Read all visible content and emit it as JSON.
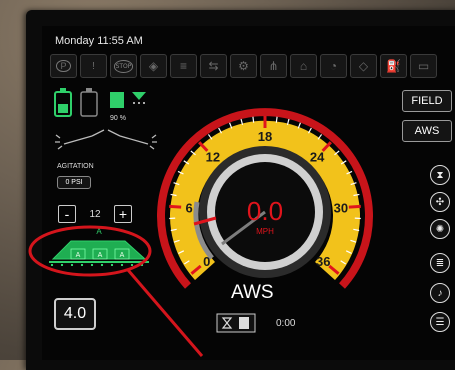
{
  "status": {
    "clock": "Monday 11:55 AM"
  },
  "top_icons": [
    {
      "name": "parking-brake-icon",
      "glyph": "P"
    },
    {
      "name": "warning-icon",
      "glyph": "!"
    },
    {
      "name": "stop-icon",
      "glyph": "STOP"
    },
    {
      "name": "hazard-lights-icon",
      "glyph": "◈"
    },
    {
      "name": "headlights-icon",
      "glyph": "≡"
    },
    {
      "name": "turn-signal-icon",
      "glyph": "⇆"
    },
    {
      "name": "engine-icon",
      "glyph": "⚙"
    },
    {
      "name": "boom-icon",
      "glyph": "⋔"
    },
    {
      "name": "hydraulic-icon",
      "glyph": "⌂"
    },
    {
      "name": "oil-icon",
      "glyph": "◔"
    },
    {
      "name": "filter-icon",
      "glyph": "◇"
    },
    {
      "name": "fuel-icon",
      "glyph": "⛽"
    },
    {
      "name": "tank-icon",
      "glyph": "▭"
    }
  ],
  "buttons": {
    "field": "FIELD",
    "aws": "AWS"
  },
  "agitation": {
    "label": "AGITATION",
    "value": "0 PSI"
  },
  "fan_pct": "90 %",
  "stepper": {
    "minus": "-",
    "value": "12",
    "plus": "+"
  },
  "boom": {
    "master": "A",
    "sections": [
      "A",
      "A",
      "A"
    ]
  },
  "speed": {
    "value": "0.0",
    "unit": "MPH",
    "min": 0,
    "max": 36,
    "ticks": [
      "0",
      "6",
      "12",
      "18",
      "24",
      "30",
      "36"
    ],
    "current": 0
  },
  "steering_mode": "AWS",
  "timer": "0:00",
  "rate_box": "4.0",
  "colors": {
    "gauge_yellow": "#f2c21b",
    "speed_red": "#e0141c",
    "active_green": "#2fd06a"
  }
}
